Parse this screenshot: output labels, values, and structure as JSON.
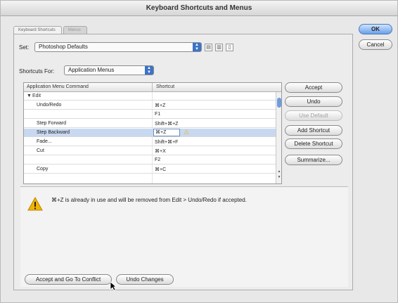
{
  "window": {
    "title": "Keyboard Shortcuts and Menus"
  },
  "tabs": [
    {
      "label": "Keyboard Shortcuts",
      "active": true
    },
    {
      "label": "Menus",
      "active": false
    }
  ],
  "set": {
    "label": "Set:",
    "value": "Photoshop Defaults"
  },
  "shortcuts_for": {
    "label": "Shortcuts For:",
    "value": "Application Menus"
  },
  "table": {
    "headers": [
      "Application Menu Command",
      "Shortcut"
    ],
    "group": "Edit",
    "rows": [
      {
        "command": "Undo/Redo",
        "shortcut": "⌘+Z"
      },
      {
        "command": "",
        "shortcut": "F1"
      },
      {
        "command": "Step Forward",
        "shortcut": "Shift+⌘+Z"
      },
      {
        "command": "Step Backward",
        "shortcut": "⌘+Z"
      },
      {
        "command": "Fade...",
        "shortcut": "Shift+⌘+F"
      },
      {
        "command": "Cut",
        "shortcut": "⌘+X"
      },
      {
        "command": "",
        "shortcut": "F2"
      },
      {
        "command": "Copy",
        "shortcut": "⌘+C"
      }
    ]
  },
  "side_buttons": {
    "accept": "Accept",
    "undo": "Undo",
    "use_default": "Use Default",
    "add_shortcut": "Add Shortcut",
    "delete_shortcut": "Delete Shortcut",
    "summarize": "Summarize..."
  },
  "dialog_buttons": {
    "ok": "OK",
    "cancel": "Cancel"
  },
  "message": "⌘+Z is already in use and will be removed from Edit > Undo/Redo if accepted.",
  "bottom_buttons": {
    "accept_conflict": "Accept and Go To Conflict",
    "undo_changes": "Undo Changes"
  },
  "colors": {
    "accent": "#3a73c8",
    "selection": "#c8d8f0",
    "warning": "#f2b400"
  },
  "icons": [
    "save-set-icon",
    "save-set-as-icon",
    "delete-set-icon",
    "warning-icon",
    "disclosure-triangle-icon",
    "mouse-cursor-icon"
  ]
}
